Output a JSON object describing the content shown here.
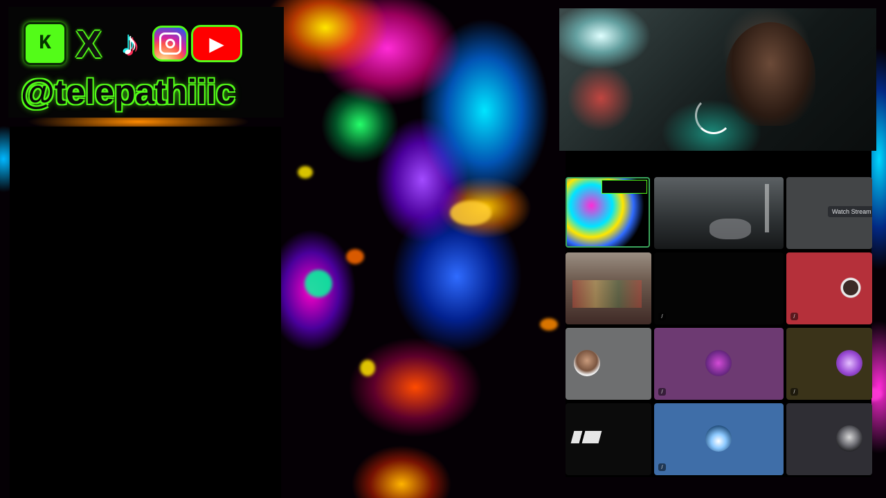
{
  "overlay": {
    "icons": [
      "kick-icon",
      "x-icon",
      "tiktok-icon",
      "instagram-icon",
      "youtube-icon"
    ],
    "kick_glyph": "K",
    "x_glyph": "X",
    "tiktok_glyph": "♪",
    "youtube_glyph": "▶",
    "handle": "@telepathiiic",
    "accent": "#53fc18"
  },
  "call": {
    "watch_stream_label": "Watch Stream",
    "tile_colors": {
      "red": "#b5303a",
      "grey": "#6e6f70",
      "purple": "#6d3a72",
      "olive": "#3a3319",
      "blue": "#3f6ea8",
      "slate": "#2f2e34"
    }
  }
}
